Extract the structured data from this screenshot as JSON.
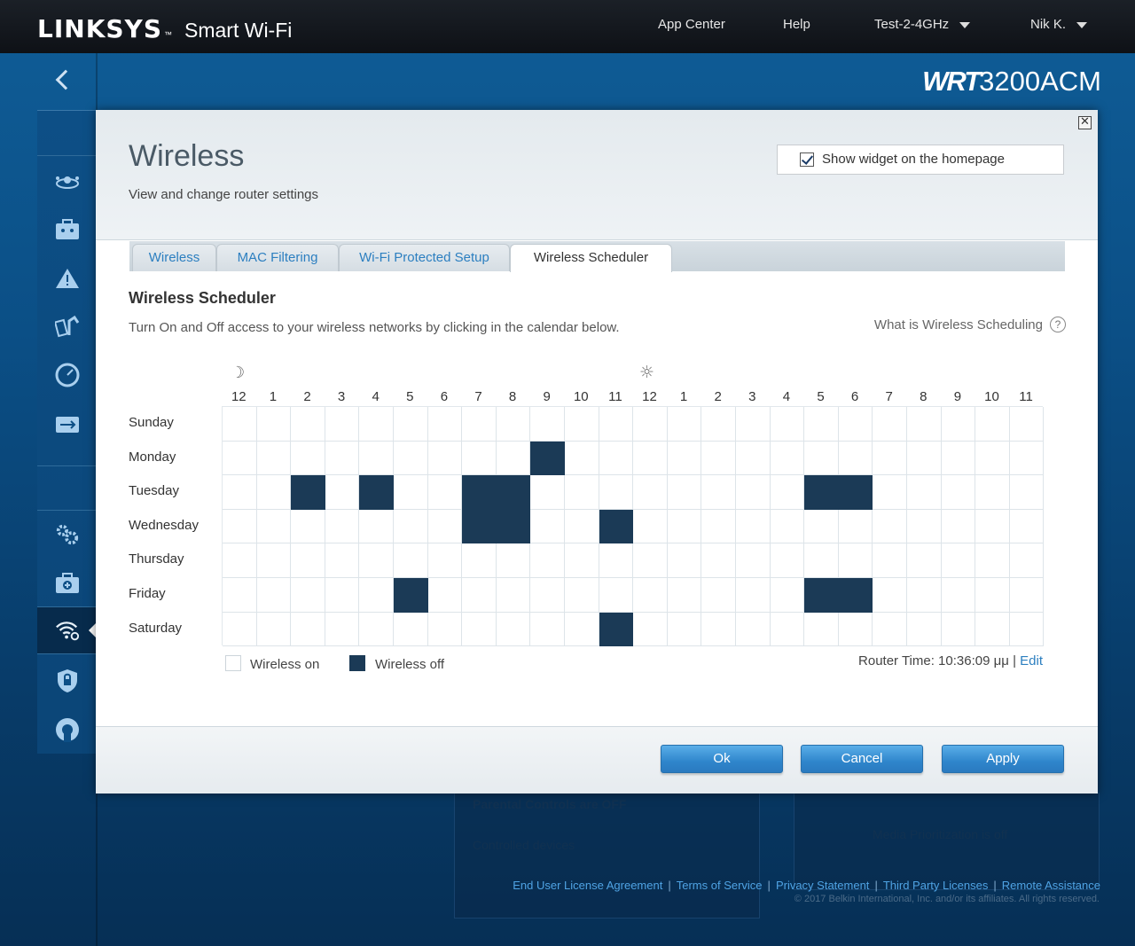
{
  "header": {
    "brand": "LINKSYS",
    "brand_tm": "™",
    "product": "Smart Wi-Fi",
    "nav": [
      {
        "label": "App Center"
      },
      {
        "label": "Help"
      },
      {
        "label": "Test-2-4GHz"
      },
      {
        "label": "Nik K."
      }
    ]
  },
  "model": {
    "bold": "WRT",
    "rest": "3200ACM"
  },
  "sidebar": {
    "icons": [
      "network-map-icon",
      "external-storage-icon",
      "alert-icon",
      "media-prioritization-icon",
      "speed-test-icon",
      "usb-storage-icon",
      "connectivity-icon",
      "troubleshooting-icon",
      "wireless-icon",
      "security-icon",
      "linksys-support-icon"
    ]
  },
  "modal": {
    "title": "Wireless",
    "subtitle": "View and change router settings",
    "close": "✕",
    "widget_label": "Show widget on the homepage",
    "widget_checked": true,
    "tabs": [
      {
        "label": "Wireless"
      },
      {
        "label": "MAC Filtering"
      },
      {
        "label": "Wi-Fi Protected Setup"
      },
      {
        "label": "Wireless Scheduler"
      }
    ],
    "active_tab": 3
  },
  "scheduler": {
    "title": "Wireless Scheduler",
    "description": "Turn On and Off access to your wireless networks by clicking in the calendar below.",
    "help_link": "What is Wireless Scheduling",
    "help_icon": "?",
    "moon": "☽",
    "sun": "☼",
    "hours": [
      "12",
      "1",
      "2",
      "3",
      "4",
      "5",
      "6",
      "7",
      "8",
      "9",
      "10",
      "11",
      "12",
      "1",
      "2",
      "3",
      "4",
      "5",
      "6",
      "7",
      "8",
      "9",
      "10",
      "11"
    ],
    "days": [
      "Sunday",
      "Monday",
      "Tuesday",
      "Wednesday",
      "Thursday",
      "Friday",
      "Saturday"
    ],
    "off_cells": [
      [],
      [
        9
      ],
      [
        2,
        4,
        7,
        8,
        17,
        18
      ],
      [
        7,
        8,
        11
      ],
      [],
      [
        5,
        17,
        18
      ],
      [
        11
      ]
    ],
    "legend_on": "Wireless on",
    "legend_off": "Wireless off",
    "router_time_label": "Router Time: 10:36:09 μμ |",
    "edit_label": "Edit",
    "colors": {
      "off": "#1b3a56",
      "on": "#ffffff"
    }
  },
  "buttons": {
    "ok": "Ok",
    "cancel": "Cancel",
    "apply": "Apply"
  },
  "background": {
    "parental_text": "Parental Controls are OFF",
    "controlled_text": "Controlled devices",
    "right_card_text": "Media Prioritization is off"
  },
  "footer": {
    "links": [
      "End User License Agreement",
      "Terms of Service",
      "Privacy Statement",
      "Third Party Licenses",
      "Remote Assistance"
    ],
    "copyright": "© 2017 Belkin International, Inc. and/or its affiliates. All rights reserved."
  }
}
